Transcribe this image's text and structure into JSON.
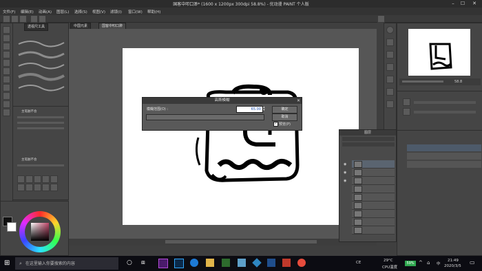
{
  "window": {
    "title": "国客中叩口渺* (1600 x 1200px 300dpi 58.8%) - 优动漫 PAINT 个人版",
    "min": "–",
    "max": "☐",
    "close": "✕"
  },
  "menu": [
    "文件(F)",
    "编辑(E)",
    "动画(A)",
    "图层(L)",
    "选择(S)",
    "视图(V)",
    "滤镜(I)",
    "窗口(W)",
    "帮助(H)"
  ],
  "tabs": {
    "left": "透视尺工具",
    "doc1": "中国元素",
    "doc2": "国客中叩口渺"
  },
  "left_panel": {
    "brush_label1": "主笔触不会",
    "brush_label2": "主笔触不会"
  },
  "dialog": {
    "title": "高斯模糊",
    "label": "模糊范围(O) :",
    "value": "65.00",
    "ok": "确定",
    "cancel": "取消",
    "preview": "预览(P)",
    "preview_checked": true
  },
  "navigator": {
    "zoom": "58.8"
  },
  "layers": {
    "title": "图层",
    "rows": 11
  },
  "taskbar": {
    "search_placeholder": "在这里输入你要搜索的内容",
    "weather": "29°C",
    "cpu": "CPU温度",
    "lang": "中",
    "ime": "CE",
    "battery": "59%",
    "time": "21:49",
    "date": "2020/3/5"
  },
  "colors": {
    "accent": "#1a4fb0",
    "taskbar": "#0c0c12"
  }
}
